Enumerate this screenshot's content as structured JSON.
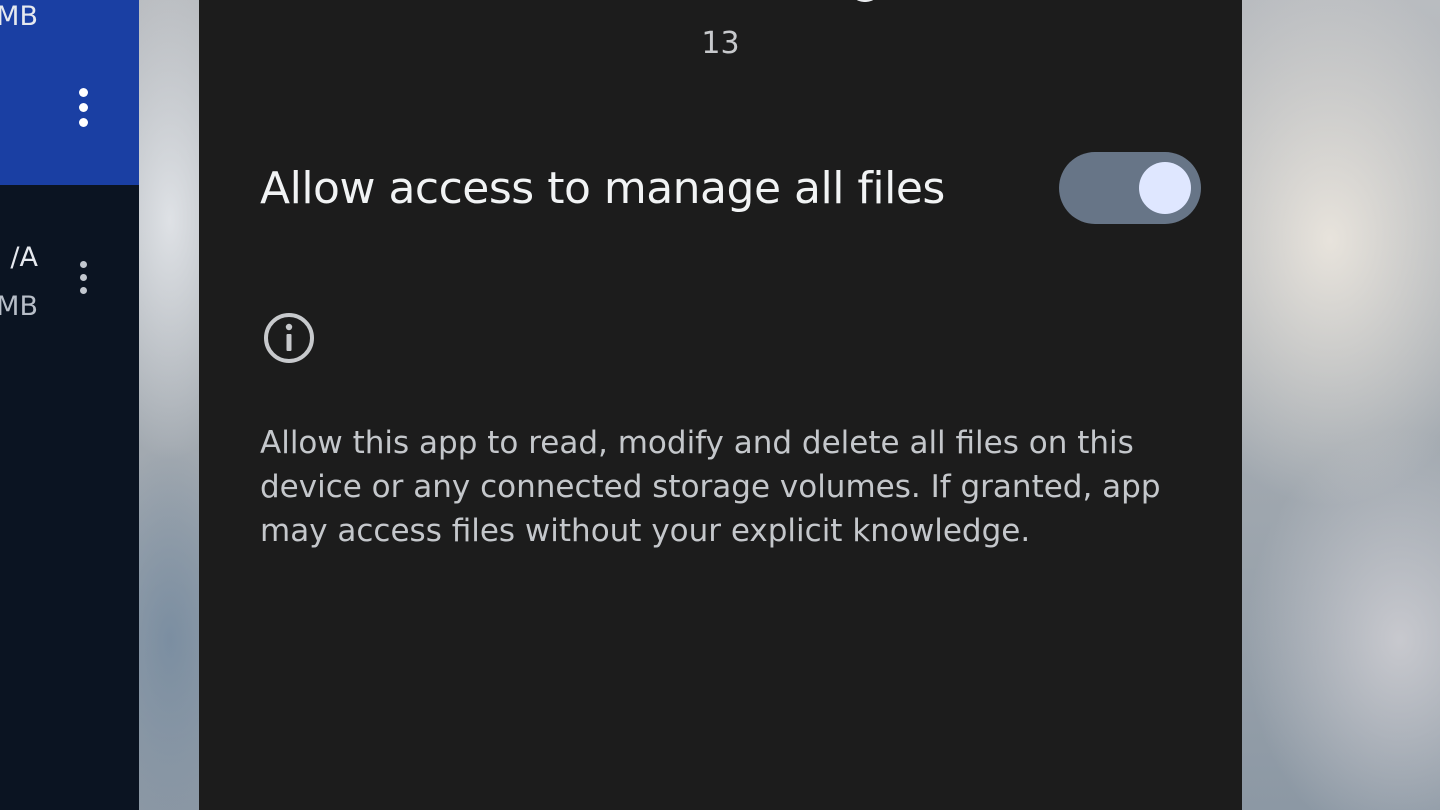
{
  "background": {
    "description_colors": {
      "sheet": "#1c1c1c",
      "left_panel": "#0b1422",
      "selected_item": "#1a3fa3"
    }
  },
  "left_panel": {
    "items": [
      {
        "line1": "",
        "line2": "MB",
        "selected": true
      },
      {
        "line1": "/A",
        "line2": "MB",
        "selected": false
      }
    ]
  },
  "permission_sheet": {
    "version_text": "13",
    "switch_label": "Allow access to manage all files",
    "switch_on": true,
    "description": "Allow this app to read, modify and delete all files on this device or any connected storage volumes. If granted, app may access files without your explicit knowledge.",
    "colors": {
      "toggle_track": "#677587",
      "toggle_thumb": "#dfe7ff"
    }
  }
}
